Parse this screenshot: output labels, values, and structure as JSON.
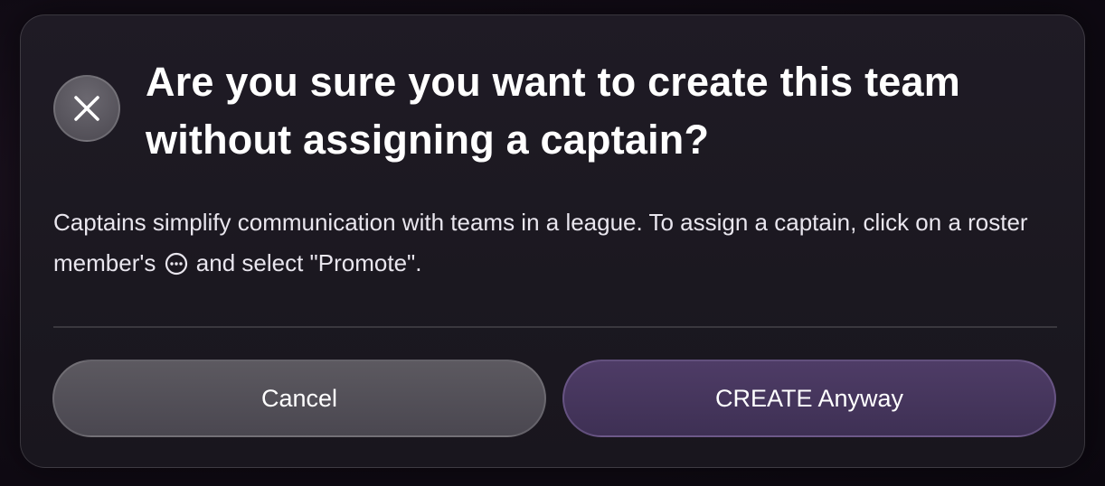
{
  "dialog": {
    "title": "Are you sure you want to create this team without assigning a captain?",
    "message_before_icon": "Captains simplify communication with teams in a league. To assign a captain, click on a roster member's",
    "message_icon": "more-options-icon",
    "message_after_icon": "and select \"Promote\".",
    "close_icon": "close-icon",
    "cancel_label": "Cancel",
    "confirm_label": "CREATE Anyway"
  },
  "colors": {
    "background": "#120c16",
    "modal": "#1d1a22",
    "cancel_button": "#524f57",
    "confirm_button": "#463659",
    "text": "#ffffff"
  }
}
